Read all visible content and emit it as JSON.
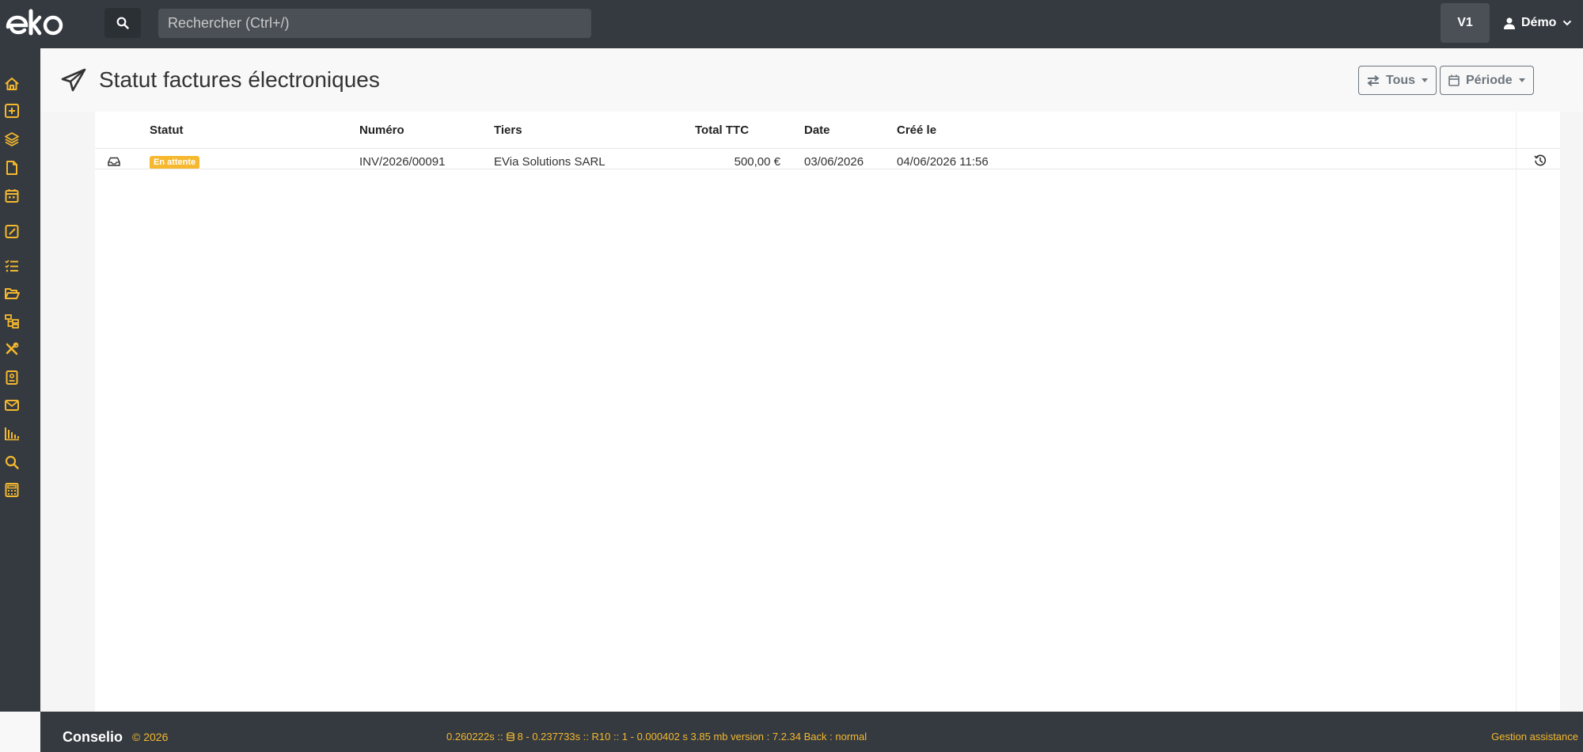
{
  "topbar": {
    "search_placeholder": "Rechercher (Ctrl+/)",
    "version_label": "V1",
    "user_name": "Démo"
  },
  "sidebar": {
    "items": [
      {
        "icon": "home-icon"
      },
      {
        "icon": "plus-square-icon"
      },
      {
        "icon": "layers-icon"
      },
      {
        "icon": "file-icon"
      },
      {
        "icon": "calendar-icon"
      },
      {
        "icon": "edit-square-icon"
      },
      {
        "icon": "list-check-icon"
      },
      {
        "icon": "folder-open-icon"
      },
      {
        "icon": "sitemap-icon"
      },
      {
        "icon": "tools-icon"
      },
      {
        "icon": "contact-book-icon"
      },
      {
        "icon": "envelope-icon"
      },
      {
        "icon": "bar-chart-icon"
      },
      {
        "icon": "search-icon"
      },
      {
        "icon": "calculator-icon"
      }
    ]
  },
  "header": {
    "title": "Statut factures électroniques",
    "filter_label": "Tous",
    "period_label": "Période"
  },
  "table": {
    "columns": [
      "Statut",
      "Numéro",
      "Tiers",
      "Total TTC",
      "Date",
      "Créé le"
    ],
    "rows": [
      {
        "status": "En attente",
        "number": "INV/2026/00091",
        "third_party": "EVia Solutions SARL",
        "total": "500,00 €",
        "date": "03/06/2026",
        "created": "04/06/2026 11:56"
      }
    ]
  },
  "footer": {
    "brand": "Conselio",
    "year": "© 2026",
    "debug_pre": "0.260222s ::",
    "debug_post": "8 - 0.237733s :: R10 :: 1 - 0.000402 s 3.85 mb version : 7.2.34 Back : normal",
    "help": "Gestion assistance"
  },
  "colors": {
    "accent": "#f5b82e",
    "dark": "#343a40"
  }
}
